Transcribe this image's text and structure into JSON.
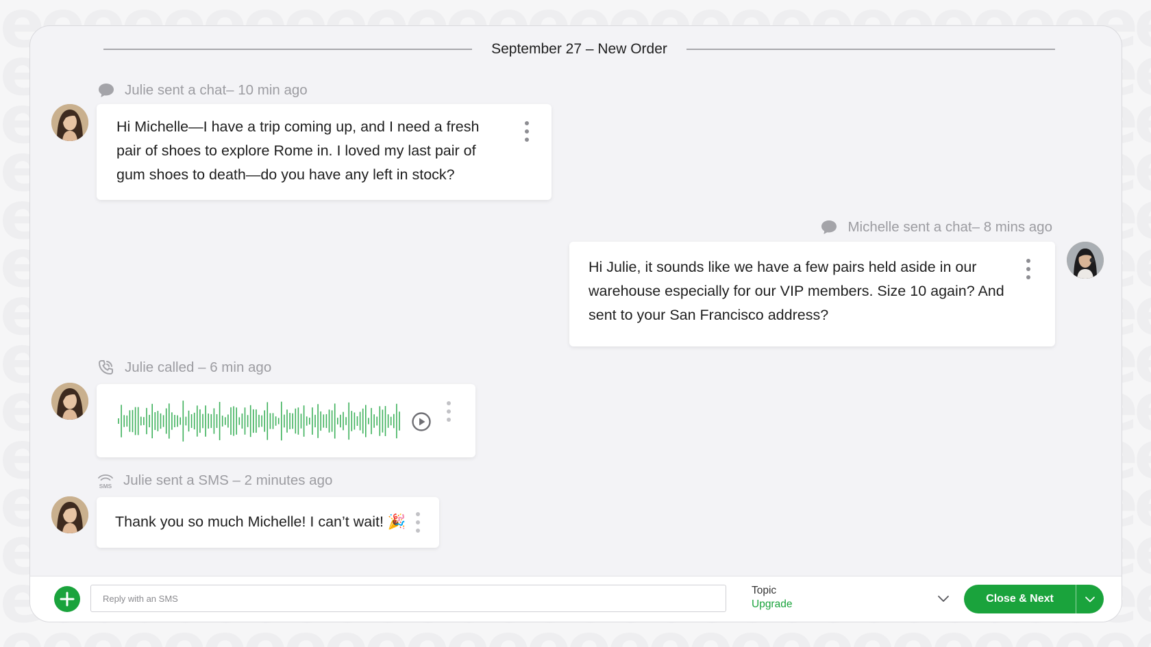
{
  "conversation": {
    "date_divider": "September 27 – New Order",
    "events": [
      {
        "meta": "Julie sent a chat– 10 min ago",
        "icon": "chat-bubble-icon",
        "message": "Hi Michelle—I have a trip coming up, and I need a fresh pair of shoes to explore Rome in. I loved my last pair of gum shoes to death—do you have any left in stock?"
      },
      {
        "meta": "Michelle sent a chat– 8 mins ago",
        "icon": "chat-bubble-icon",
        "message": "Hi Julie, it sounds like we have a few pairs held aside in our warehouse especially for our VIP members. Size 10 again? And sent to your San Francisco address?"
      },
      {
        "meta": "Julie called – 6 min ago",
        "icon": "phone-call-icon",
        "attachment": "voice-recording"
      },
      {
        "meta": "Julie sent a SMS – 2 minutes ago",
        "icon": "sms-icon",
        "message": "Thank you so much Michelle! I can’t wait! 🎉"
      }
    ]
  },
  "composer": {
    "reply_placeholder": "Reply with an SMS",
    "topic_label": "Topic",
    "topic_value": "Upgrade",
    "primary_button": "Close & Next"
  },
  "colors": {
    "accent": "#1aa33c",
    "waveform": "#3cb05a",
    "background": "#f3f3f6"
  }
}
